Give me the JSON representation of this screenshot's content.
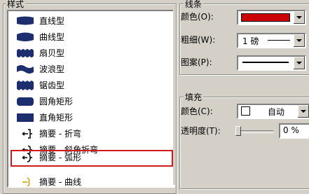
{
  "style_group": {
    "title": "样式",
    "items": [
      {
        "label": "直线型",
        "icon": "straight-line-callout-icon"
      },
      {
        "label": "曲线型",
        "icon": "curved-line-callout-icon"
      },
      {
        "label": "扇贝型",
        "icon": "scallop-callout-icon"
      },
      {
        "label": "波浪型",
        "icon": "wave-callout-icon"
      },
      {
        "label": "锯齿型",
        "icon": "zigzag-callout-icon"
      },
      {
        "label": "圆角矩形",
        "icon": "rounded-rectangle-callout-icon"
      },
      {
        "label": "直角矩形",
        "icon": "rectangle-callout-icon"
      },
      {
        "label": "摘要 - 折弯",
        "icon": "summary-bent-bracket-icon"
      },
      {
        "label": "摘要 - 斜角折弯",
        "icon": "summary-bevel-bracket-icon"
      },
      {
        "label": "摘要 - 弧形",
        "icon": "summary-arc-bracket-icon"
      },
      {
        "label": "摘要 - 曲线",
        "icon": "summary-curve-bracket-icon"
      }
    ],
    "selected_index": 9
  },
  "line_group": {
    "title": "线条",
    "color_label": "颜色(O):",
    "color_value": "#cc0000",
    "weight_label": "粗细(W):",
    "weight_value": "1 磅",
    "pattern_label": "图案(P):"
  },
  "fill_group": {
    "title": "填充",
    "color_label": "颜色(C):",
    "color_value": "自动",
    "transparency_label": "透明度(T):",
    "transparency_value": "0 %"
  }
}
